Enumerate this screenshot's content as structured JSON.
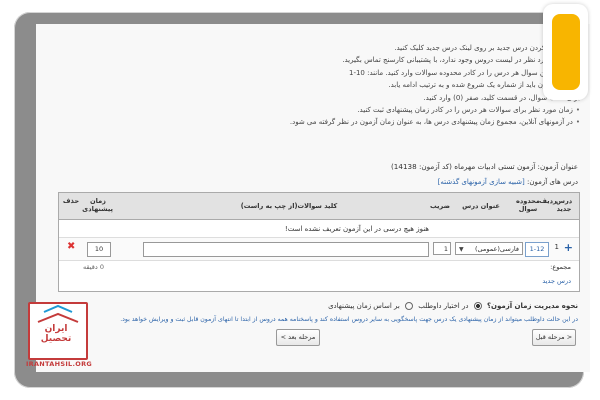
{
  "instructions": [
    "برای اضافه کردن درس جدید بر روی لینک درس جدید کلیک کنید.",
    "اگر درس مورد نظر در لیست دروس وجود ندارد، با پشتیبانی کارسنج تماس بگیرید.",
    "اولین و آخرین سوال هر درس را در کادر محدوده سوالات وارد کنید. مانند: 10-1",
    "سوالات آزمون باید از شماره یک شروع شده و به ترتیب ادامه یابد.",
    "برای حذف سوال، در قسمت کلید، صفر (0) وارد کنید.",
    "زمان مورد نظر برای سوالات هر درس را در کادر زمان پیشنهادی ثبت کنید.",
    "در آزمونهای آنلاین، مجموع زمان پیشنهادی درس ها، به عنوان زمان آزمون در نظر گرفته می شود."
  ],
  "exam": {
    "title": "عنوان آزمون: آزمون تستی ادبیات مهرماه (کد آزمون: 14138)",
    "lessons_label": "درس های آزمون:",
    "similar_link": "[شبیه سازی آزمونهای گذشته]"
  },
  "table": {
    "headers": {
      "new_lesson": "درس جدید",
      "row": "ردیف",
      "range": "محدوده سوال",
      "lesson_title": "عنوان درس",
      "coef": "ضریب",
      "keys": "کلید سوالات(از چپ به راست)",
      "time": "زمان پیشنهادی",
      "delete": "حذف"
    },
    "empty_message": "هنوز هیچ درسی در این آزمون تعریف نشده است!",
    "row": {
      "number": "1",
      "range": "1-12",
      "lesson": "فارسی(عمومی)",
      "coef": "1",
      "keys": "",
      "time": "10"
    },
    "total_label": "مجموع:",
    "total_minutes": "0 دقیقه",
    "new_lesson_link": "درس جدید"
  },
  "time_management": {
    "question": "نحوه مدیریت زمان آزمون؟",
    "option_candidate": "در اختیار داوطلب",
    "option_suggested": "بر اساس زمان پیشنهادی",
    "selected": "option_candidate",
    "note": "در این حالت داوطلب میتواند از زمان پیشنهادی یک درس جهت پاسخگویی به سایر دروس استفاده کند و پاسخنامه همه دروس از ابتدا تا انتهای آزمون قابل ثبت و ویرایش خواهد بود."
  },
  "buttons": {
    "prev": "< مرحله قبل",
    "next": "مرحله بعد >"
  },
  "logo": {
    "name_fa": "ایران تحصیل",
    "name_en": "IRANTAHSIL.ORG"
  },
  "colors": {
    "accent_yellow": "#f8b500",
    "link_blue": "#2a62a8",
    "delete_red": "#dd3333",
    "logo_red": "#c43b3b"
  }
}
